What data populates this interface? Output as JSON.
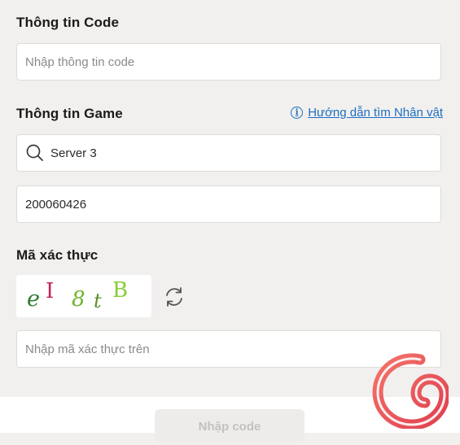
{
  "code_section": {
    "title": "Thông tin Code",
    "placeholder": "Nhập thông tin code"
  },
  "game_section": {
    "title": "Thông tin Game",
    "help_link": "Hướng dẫn tìm Nhân vật",
    "server_value": "Server 3",
    "character_id": "200060426"
  },
  "captcha_section": {
    "title": "Mã xác thực",
    "captcha_chars": [
      "e",
      "I",
      "8",
      "t",
      "B"
    ],
    "placeholder": "Nhập mã xác thực trên"
  },
  "footer": {
    "submit_label": "Nhập code"
  },
  "colors": {
    "background": "#f2f0ee",
    "link": "#1b6ec2",
    "logo": "#e8505b"
  },
  "icons": {
    "help": "info-icon",
    "server": "search-icon",
    "refresh": "refresh-icon",
    "logo": "brand-logo-icon"
  }
}
